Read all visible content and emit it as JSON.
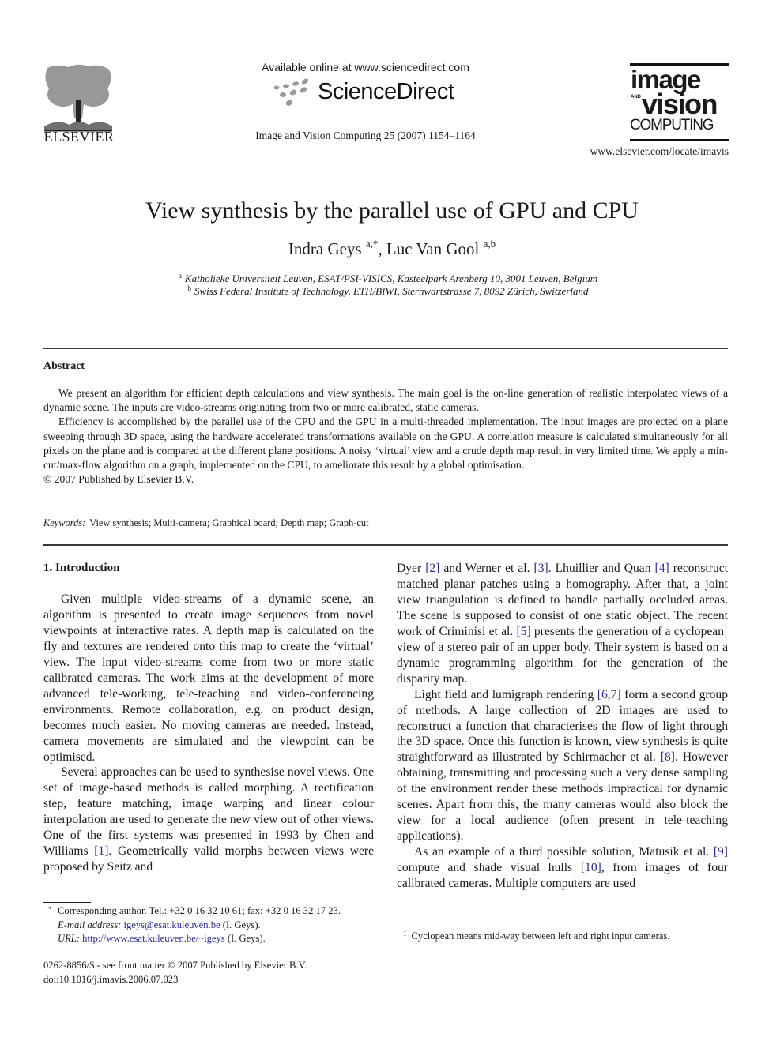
{
  "header": {
    "publisher_wordmark": "ELSEVIER",
    "available_online": "Available online at www.sciencedirect.com",
    "sciencedirect_wordmark": "ScienceDirect",
    "journal_reference": "Image and Vision Computing 25 (2007) 1154–1164",
    "journal_logo": {
      "line1": "image",
      "and": "AND",
      "line2": "vision",
      "line3": "COMPUTING"
    },
    "journal_url": "www.elsevier.com/locate/imavis"
  },
  "article": {
    "title": "View synthesis by the parallel use of GPU and CPU",
    "authors": [
      {
        "name": "Indra Geys",
        "marks": "a,*"
      },
      {
        "name": "Luc Van Gool",
        "marks": "a,b"
      }
    ],
    "author_separator": ", ",
    "affiliations": [
      {
        "mark": "a",
        "text": "Katholieke Universiteit Leuven, ESAT/PSI-VISICS, Kasteelpark Arenberg 10, 3001 Leuven, Belgium"
      },
      {
        "mark": "b",
        "text": "Swiss Federal Institute of Technology, ETH/BIWI, Sternwartstrasse 7, 8092 Zürich, Switzerland"
      }
    ]
  },
  "abstract": {
    "heading": "Abstract",
    "paragraphs": [
      "We present an algorithm for efficient depth calculations and view synthesis. The main goal is the on-line generation of realistic interpolated views of a dynamic scene. The inputs are video-streams originating from two or more calibrated, static cameras.",
      "Efficiency is accomplished by the parallel use of the CPU and the GPU in a multi-threaded implementation. The input images are projected on a plane sweeping through 3D space, using the hardware accelerated transformations available on the GPU. A correlation measure is calculated simultaneously for all pixels on the plane and is compared at the different plane positions. A noisy ‘virtual’ view and a crude depth map result in very limited time. We apply a min-cut/max-flow algorithm on a graph, implemented on the CPU, to ameliorate this result by a global optimisation."
    ],
    "copyright": "© 2007 Published by Elsevier B.V.",
    "keywords_label": "Keywords:",
    "keywords": "View synthesis; Multi-camera; Graphical board; Depth map; Graph-cut"
  },
  "introduction": {
    "heading": "1. Introduction",
    "left_column": {
      "p1": "Given multiple video-streams of a dynamic scene, an algorithm is presented to create image sequences from novel viewpoints at interactive rates. A depth map is calculated on the fly and textures are rendered onto this map to create the ‘virtual’ view. The input video-streams come from two or more static calibrated cameras. The work aims at the development of more advanced tele-working, tele-teaching and video-conferencing environments. Remote collaboration, e.g. on product design, becomes much easier. No moving cameras are needed. Instead, camera movements are simulated and the viewpoint can be optimised.",
      "p2_before_ref1": "Several approaches can be used to synthesise novel views. One set of image-based methods is called morphing. A rectification step, feature matching, image warping and linear colour interpolation are used to generate the new view out of other views. One of the first systems was presented in 1993 by Chen and Williams ",
      "ref1": "[1]",
      "p2_after_ref1": ". Geometrically valid morphs between views were proposed by Seitz and"
    },
    "right_column": {
      "p2_cont_a": "Dyer ",
      "ref2": "[2]",
      "p2_cont_b": " and Werner et al. ",
      "ref3": "[3]",
      "p2_cont_c": ". Lhuillier and Quan ",
      "ref4": "[4]",
      "p2_cont_d": " reconstruct matched planar patches using a homography. After that, a joint view triangulation is defined to handle partially occluded areas. The scene is supposed to consist of one static object. The recent work of Criminisi et al. ",
      "ref5": "[5]",
      "p2_cont_e": " presents the generation of a cyclopean",
      "fn_mark": "1",
      "p2_cont_f": " view of a stereo pair of an upper body. Their system is based on a dynamic programming algorithm for the generation of the disparity map.",
      "p3_a": "Light field and lumigraph rendering ",
      "ref67": "[6,7]",
      "p3_b": " form a second group of methods. A large collection of 2D images are used to reconstruct a function that characterises the flow of light through the 3D space. Once this function is known, view synthesis is quite straightforward as illustrated by Schirmacher et al. ",
      "ref8": "[8]",
      "p3_c": ". However obtaining, transmitting and processing such a very dense sampling of the environment render these methods impractical for dynamic scenes. Apart from this, the many cameras would also block the view for a local audience (often present in tele-teaching applications).",
      "p4_a": "As an example of a third possible solution, Matusik et al. ",
      "ref9": "[9]",
      "p4_b": " compute and shade visual hulls ",
      "ref10": "[10]",
      "p4_c": ", from images of four calibrated cameras. Multiple computers are used"
    }
  },
  "footnotes": {
    "corresponding": {
      "mark": "*",
      "text": "Corresponding author. Tel.: +32 0 16 32 10 61; fax: +32 0 16 32 17 23.",
      "email_label": "E-mail address:",
      "email": "igeys@esat.kuleuven.be",
      "email_suffix": " (I. Geys).",
      "url_label": "URL:",
      "url": "http://www.esat.kuleuven.be/~igeys",
      "url_suffix": " (I. Geys)."
    },
    "footnote_1": {
      "mark": "1",
      "text": "Cyclopean means mid-way between left and right input cameras."
    }
  },
  "front_matter": {
    "issn_line": "0262-8856/$ - see front matter © 2007 Published by Elsevier B.V.",
    "doi": "doi:10.1016/j.imavis.2006.07.023"
  },
  "colors": {
    "link": "#2b2b8c",
    "text": "#1a1a1a",
    "logo_dots": "#9a9a9a"
  }
}
